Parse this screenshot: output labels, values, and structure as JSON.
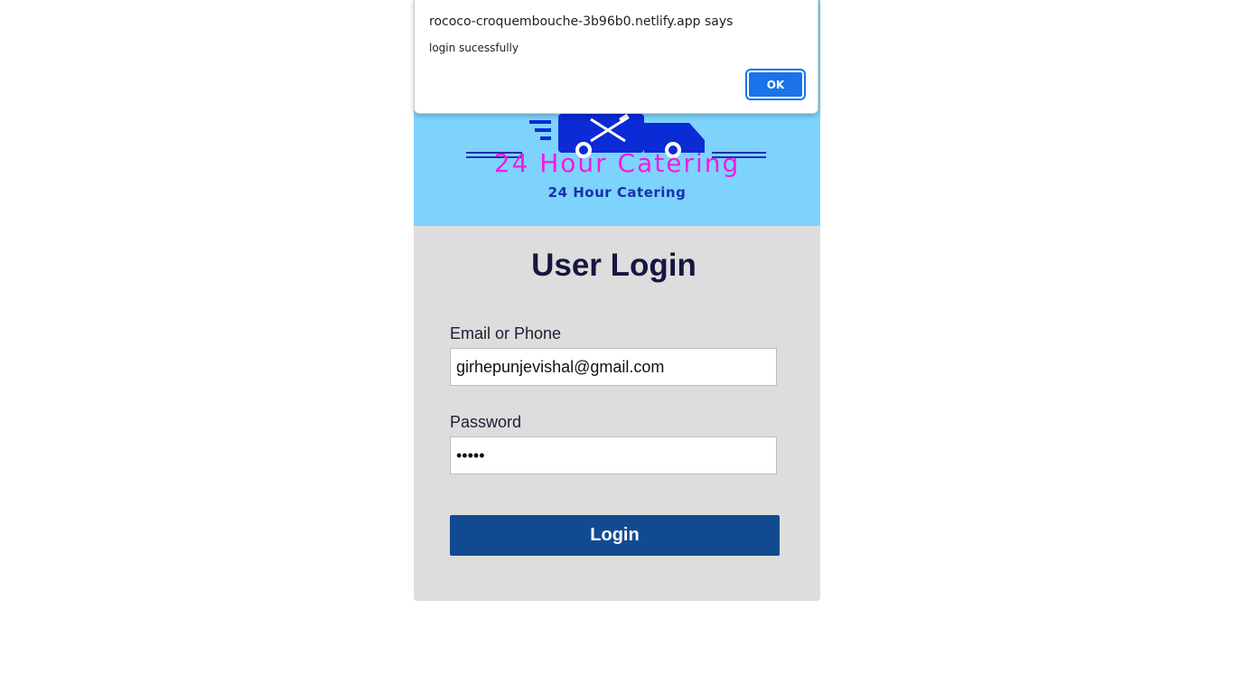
{
  "banner": {
    "title": "24 Hour Catering",
    "subtitle": "24 Hour Catering",
    "background_color": "#7dd3fb",
    "title_color": "#f21ae4",
    "subtitle_color": "#1b2fb0",
    "logo_icon": "food-truck-icon"
  },
  "login": {
    "heading": "User Login",
    "email_label": "Email or Phone",
    "email_value": "girhepunjevishal@gmail.com",
    "password_label": "Password",
    "password_value": "•••••",
    "button_label": "Login",
    "button_color": "#124a91",
    "card_color": "#dddddd"
  },
  "dialog": {
    "title": "rococo-croquembouche-3b96b0.netlify.app says",
    "message": "login sucessfully",
    "ok_label": "OK",
    "ok_color": "#1a73e8"
  }
}
